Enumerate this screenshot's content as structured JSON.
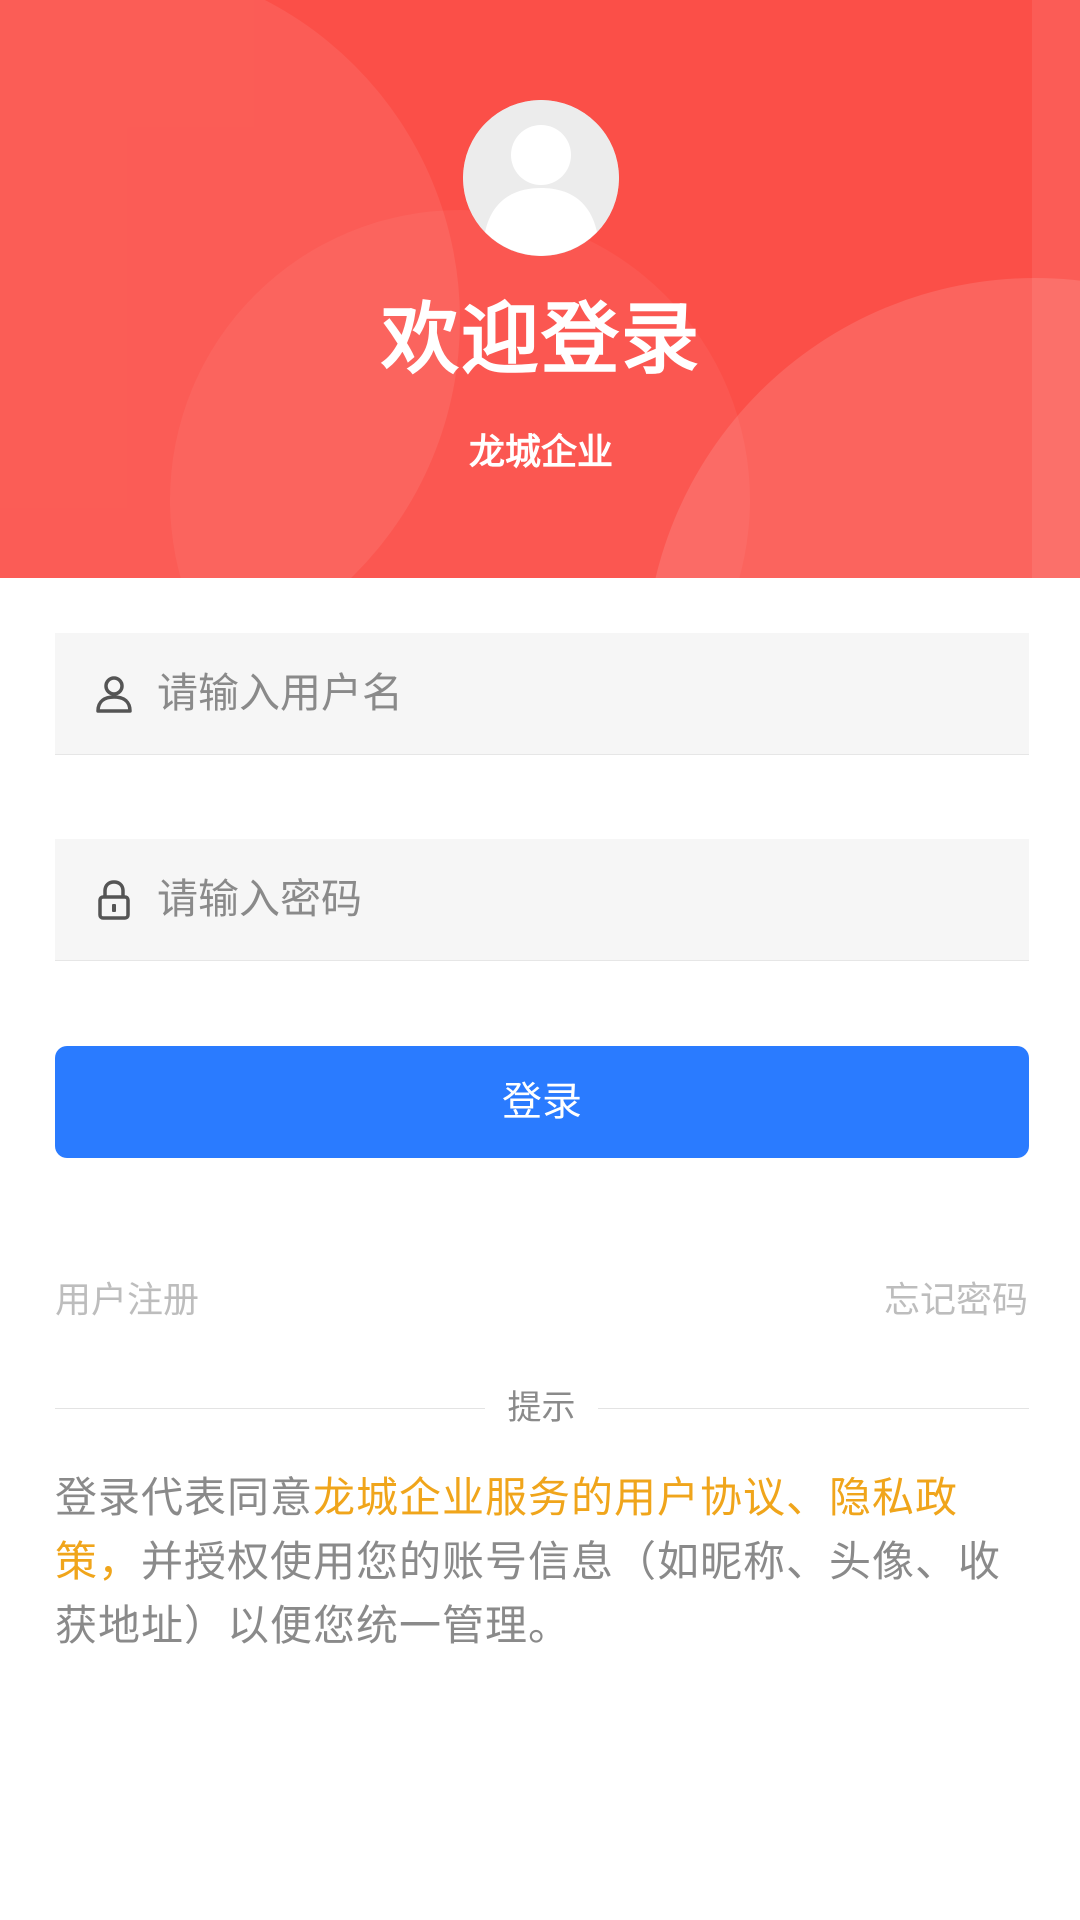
{
  "header": {
    "title": "欢迎登录",
    "company": "龙城企业"
  },
  "form": {
    "username_placeholder": "请输入用户名",
    "password_placeholder": "请输入密码",
    "login_label": "登录"
  },
  "links": {
    "register": "用户注册",
    "forgot_password": "忘记密码"
  },
  "tips": {
    "label": "提示",
    "prefix": "登录代表同意",
    "highlight": "龙城企业服务的用户协议、隐私政策，",
    "suffix": "并授权使用您的账号信息（如昵称、头像、收获地址）以便您统一管理。"
  },
  "colors": {
    "header_red": "#fb4f48",
    "button_blue": "#2a7bff",
    "highlight_orange": "#f0a51b",
    "muted_gray": "#8a8a8a"
  },
  "icons": {
    "avatar": "avatar-icon",
    "username": "user-icon",
    "password": "lock-icon"
  }
}
